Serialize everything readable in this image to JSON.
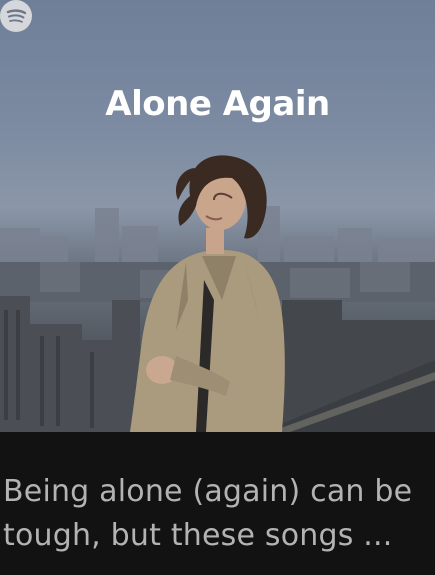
{
  "playlist": {
    "cover_title": "Alone Again",
    "description": "Being alone (again) can be tough, but these songs ...",
    "brand_icon": "spotify-icon"
  },
  "colors": {
    "background": "#121212",
    "title": "#ffffff",
    "description": "#b3b3b3"
  }
}
